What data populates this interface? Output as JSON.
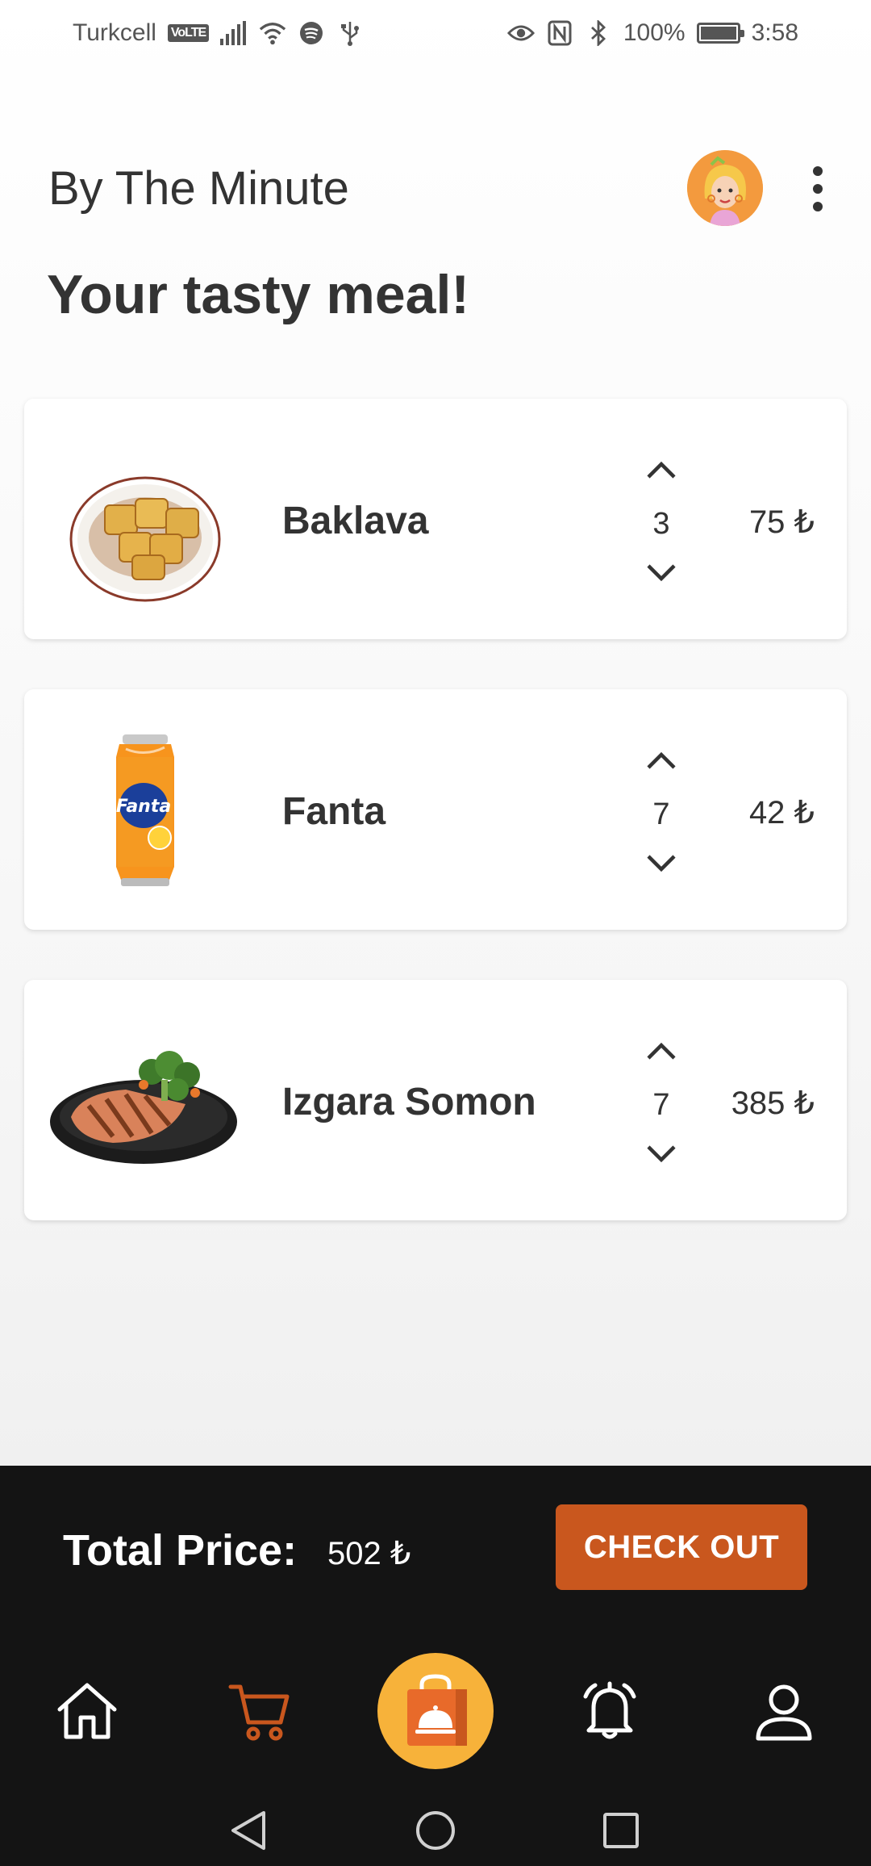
{
  "status_bar": {
    "carrier": "Turkcell",
    "volte": "VoLTE",
    "battery": "100%",
    "time": "3:58"
  },
  "header": {
    "app_title": "By The Minute",
    "page_heading": "Your tasty meal!"
  },
  "cart": {
    "items": [
      {
        "name": "Baklava",
        "quantity": "3",
        "price": "75 ₺",
        "image": "baklava-plate"
      },
      {
        "name": "Fanta",
        "quantity": "7",
        "price": "42 ₺",
        "image": "fanta-can"
      },
      {
        "name": "Izgara Somon",
        "quantity": "7",
        "price": "385 ₺",
        "image": "grilled-salmon-plate"
      }
    ]
  },
  "footer": {
    "total_label": "Total Price:",
    "total_value": "502 ₺",
    "checkout_label": "CHECK OUT"
  },
  "nav": {
    "items": [
      "home-icon",
      "cart-icon",
      "food-bag-icon",
      "bell-icon",
      "user-icon"
    ],
    "active": "cart-icon"
  },
  "colors": {
    "accent": "#C9571E",
    "center_button": "#F7B23A",
    "panel": "#141414",
    "text": "#333333"
  }
}
